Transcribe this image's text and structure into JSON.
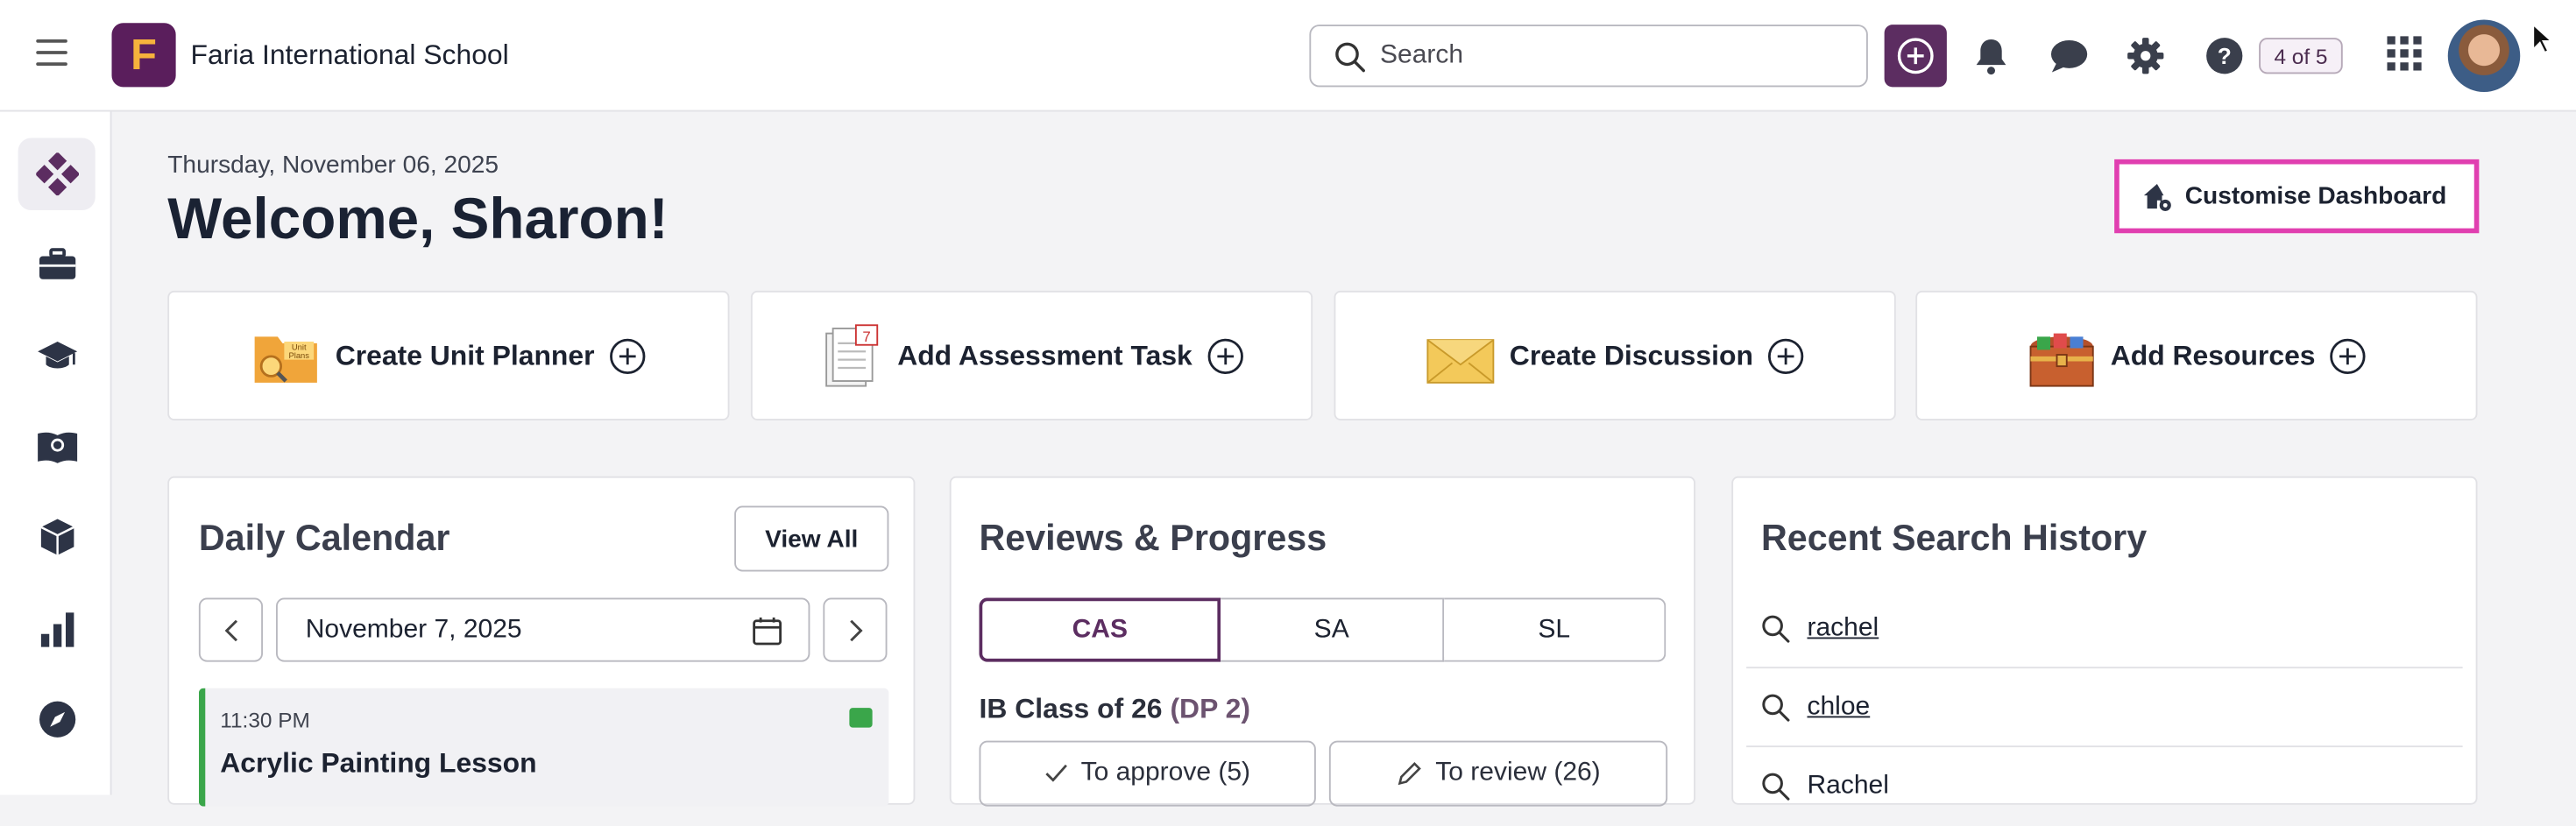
{
  "header": {
    "school_name": "Faria International School",
    "logo_letter": "F",
    "search_placeholder": "Search",
    "pager": "4 of 5"
  },
  "sidebar": {
    "items": [
      {
        "icon": "dashboard-icon",
        "active": true
      },
      {
        "icon": "briefcase-icon",
        "active": false
      },
      {
        "icon": "graduation-cap-icon",
        "active": false
      },
      {
        "icon": "book-globe-icon",
        "active": false
      },
      {
        "icon": "cube-icon",
        "active": false
      },
      {
        "icon": "bar-chart-icon",
        "active": false
      },
      {
        "icon": "compass-icon",
        "active": false
      }
    ]
  },
  "main": {
    "date": "Thursday, November 06, 2025",
    "welcome": "Welcome, Sharon!",
    "customise_label": "Customise Dashboard"
  },
  "quick_actions": [
    {
      "label": "Create Unit Planner",
      "icon": "unit-planner-folder-icon"
    },
    {
      "label": "Add Assessment Task",
      "icon": "assessment-notepad-icon"
    },
    {
      "label": "Create Discussion",
      "icon": "envelope-icon"
    },
    {
      "label": "Add Resources",
      "icon": "treasure-chest-icon"
    }
  ],
  "calendar": {
    "title": "Daily Calendar",
    "view_all": "View All",
    "date_value": "November 7, 2025",
    "event": {
      "time": "11:30 PM",
      "name": "Acrylic Painting Lesson"
    }
  },
  "reviews": {
    "title": "Reviews & Progress",
    "tabs": [
      "CAS",
      "SA",
      "SL"
    ],
    "active_tab": "CAS",
    "class_label": "IB Class of 26",
    "class_dp": "(DP 2)",
    "to_approve": "To approve (5)",
    "to_review": "To review (26)"
  },
  "history": {
    "title": "Recent Search History",
    "items": [
      " rachel",
      " chloe",
      "Rachel"
    ]
  },
  "colors": {
    "brand_purple": "#5c2d61",
    "highlight_pink": "#e03fb0",
    "event_green": "#3aa64a"
  }
}
